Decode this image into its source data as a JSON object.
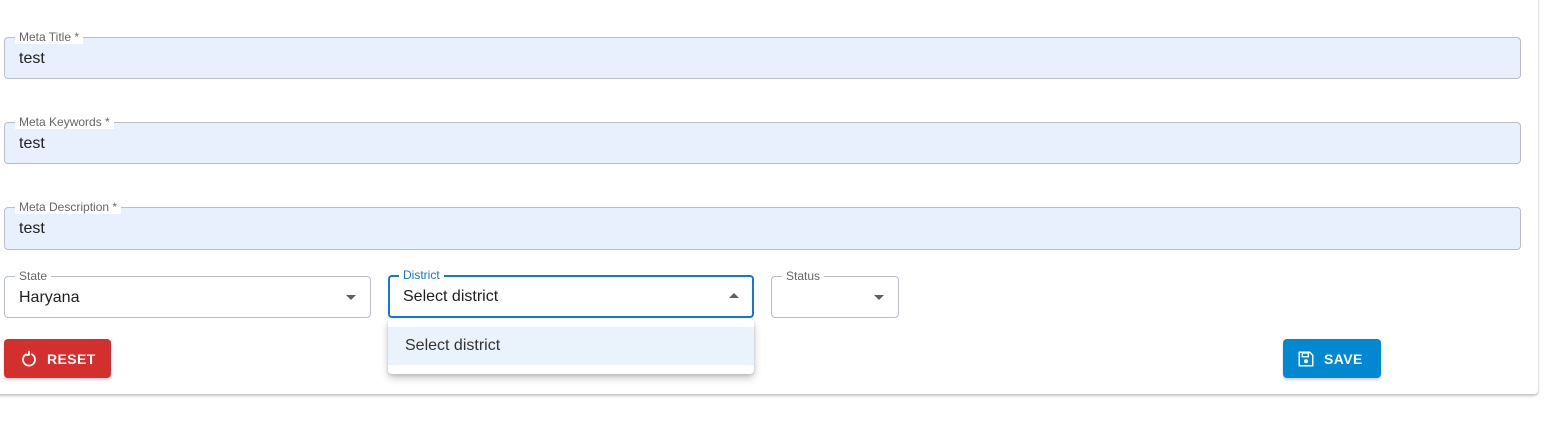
{
  "form": {
    "meta_title": {
      "label": "Meta Title *",
      "value": "test"
    },
    "meta_keywords": {
      "label": "Meta Keywords *",
      "value": "test"
    },
    "meta_description": {
      "label": "Meta Description *",
      "value": "test"
    },
    "state": {
      "label": "State",
      "value": "Haryana"
    },
    "district": {
      "label": "District",
      "value": "Select district",
      "options": [
        "Select district"
      ]
    },
    "status": {
      "label": "Status",
      "value": ""
    }
  },
  "buttons": {
    "reset_label": "RESET",
    "save_label": "SAVE"
  },
  "icons": {
    "reset": "restart-icon",
    "save": "save-icon",
    "dropdown": "arrow-drop-down-icon"
  },
  "colors": {
    "accent": "#1976d2",
    "reset": "#d32f2f",
    "save": "#0288d1",
    "filled_bg": "#e8f0fe"
  }
}
